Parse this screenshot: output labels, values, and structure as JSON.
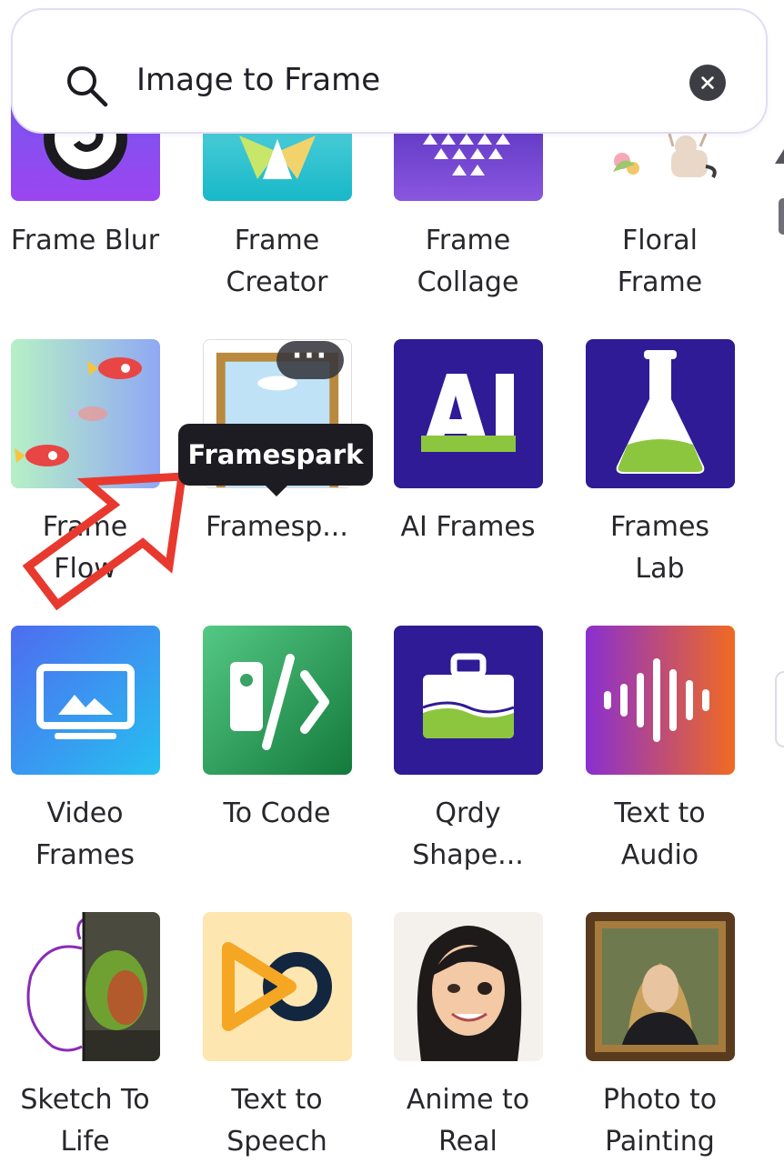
{
  "search": {
    "query": "Image to Frame",
    "icon": "search-icon",
    "clear_icon": "close-icon"
  },
  "tooltip": {
    "text": "Framespark"
  },
  "more_options": {
    "label": "···"
  },
  "apps": [
    {
      "name": "Frame Blur",
      "lines": [
        "Frame Blur"
      ]
    },
    {
      "name": "Frame Creator",
      "lines": [
        "Frame",
        "Creator"
      ]
    },
    {
      "name": "Frame Collage",
      "lines": [
        "Frame",
        "Collage"
      ]
    },
    {
      "name": "Floral Frame",
      "lines": [
        "Floral",
        "Frame"
      ]
    },
    {
      "name": "Frame Flow",
      "lines": [
        "Frame",
        "Flow"
      ]
    },
    {
      "name": "Framespark",
      "lines": [
        "Framesp..."
      ]
    },
    {
      "name": "AI Frames",
      "lines": [
        "AI Frames"
      ]
    },
    {
      "name": "Frames Lab",
      "lines": [
        "Frames",
        "Lab"
      ]
    },
    {
      "name": "Video Frames",
      "lines": [
        "Video",
        "Frames"
      ]
    },
    {
      "name": "To Code",
      "lines": [
        "To Code"
      ]
    },
    {
      "name": "Qrdy Shape",
      "lines": [
        "Qrdy",
        "Shape..."
      ]
    },
    {
      "name": "Text to Audio",
      "lines": [
        "Text to",
        "Audio"
      ]
    },
    {
      "name": "Sketch To Life",
      "lines": [
        "Sketch To",
        "Life"
      ]
    },
    {
      "name": "Text to Speech",
      "lines": [
        "Text to",
        "Speech"
      ]
    },
    {
      "name": "Anime to Real",
      "lines": [
        "Anime to",
        "Real"
      ]
    },
    {
      "name": "Photo to Painting",
      "lines": [
        "Photo to",
        "Painting"
      ]
    }
  ],
  "colors": {
    "annotation_arrow": "#e8392f",
    "tooltip_bg": "#1d1c22",
    "search_border": "#e3dcf3"
  }
}
